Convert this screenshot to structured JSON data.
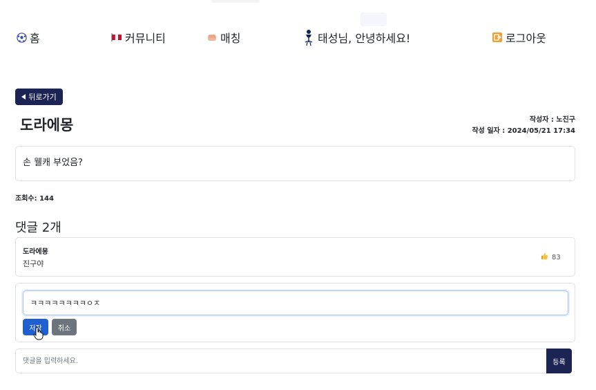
{
  "nav": {
    "home": {
      "label": "홈",
      "icon": "soccer-ball-icon"
    },
    "community": {
      "label": "커뮤니티",
      "icon": "flag-icon"
    },
    "match": {
      "label": "매칭",
      "icon": "fist-icon"
    },
    "greeting": {
      "label": "태성님, 안녕하세요!",
      "icon": "team-crest-icon"
    },
    "logout": {
      "label": "로그아웃",
      "icon": "exit-icon"
    }
  },
  "back_button": {
    "label": "뒤로가기"
  },
  "post": {
    "title": "도라에몽",
    "author_line": "작성자 : 노진구",
    "date_line": "작성 일자 : 2024/05/21 17:34",
    "content": "손 웰캐 부었음?",
    "views": "조회수: 144"
  },
  "comments": {
    "heading": "댓글 2개",
    "items": [
      {
        "author": "도라에몽",
        "text": "진구야",
        "likes": "83"
      }
    ]
  },
  "edit": {
    "value": "ㅋㅋㅋㅋㅋㅋㅋㅋㅇㅈ",
    "save_label": "저장",
    "cancel_label": "취소"
  },
  "new_comment": {
    "placeholder": "댓글을 입력하세요.",
    "submit_label": "등록"
  },
  "colors": {
    "navy": "#1b2452",
    "primary": "#1f5fd1",
    "secondary": "#6c757d"
  }
}
